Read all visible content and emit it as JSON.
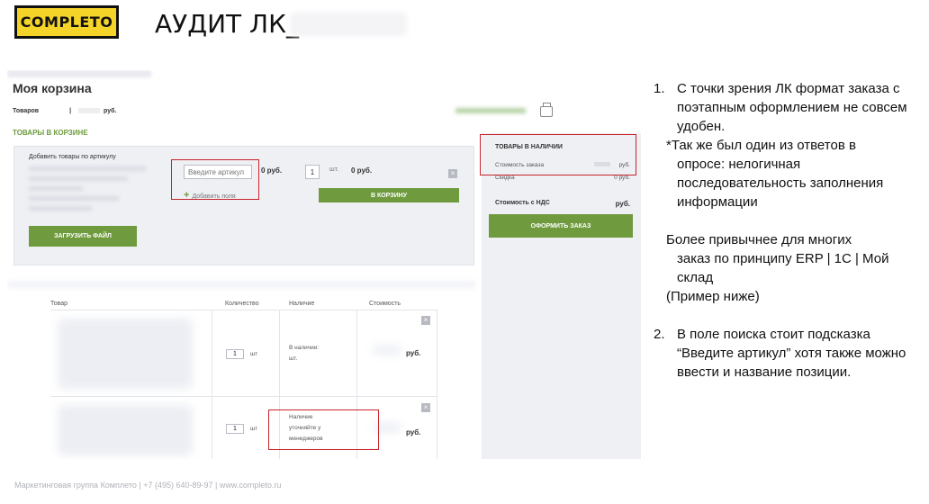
{
  "logo": {
    "text": "COMPLETO"
  },
  "slide": {
    "title": "АУДИТ ЛК_"
  },
  "cart": {
    "title": "Моя корзина",
    "goods_label": "Товаров",
    "goods_sep": "|",
    "goods_currency": "руб.",
    "in_cart_label": "ТОВАРЫ В КОРЗИНЕ",
    "add_by_article_title": "Добавить товары по артикулу",
    "article_placeholder": "Введите артикул",
    "price_zero": "0 руб.",
    "qty_value": "1",
    "qty_unit": "шт.",
    "price_zero_total": "0 руб.",
    "add_field_label": "Добавить поля",
    "to_cart_button": "В КОРЗИНУ",
    "upload_file_button": "ЗАГРУЗИТЬ ФАЙЛ"
  },
  "summary": {
    "title": "ТОВАРЫ В НАЛИЧИИ",
    "cost_label": "Стоимость заказа",
    "cost_value": "руб.",
    "discount_label": "Скидка",
    "discount_value": "0 руб.",
    "total_label": "Стоимость с НДС",
    "total_value": "руб.",
    "checkout_button": "ОФОРМИТЬ ЗАКАЗ"
  },
  "table": {
    "columns": [
      "Товар",
      "Количество",
      "Наличие",
      "Стоимость"
    ],
    "rows": [
      {
        "qty": "1",
        "unit": "шт",
        "availability": "В наличии:\nшт.",
        "price": "руб."
      },
      {
        "qty": "1",
        "unit": "шт",
        "availability": "Наличие\nуточняйте у\nменеджеров",
        "price": "руб."
      }
    ]
  },
  "notes": {
    "item1_num": "1.",
    "item1_text": "С точки зрения ЛК формат заказа с поэтапным оформлением не совсем удобен.",
    "note_asterisk_first": "*Так же был один из ответов в",
    "note_asterisk_rest": "опросе: нелогичная последовательность заполнения информации",
    "para_first": "Более привычнее для многих",
    "para_rest": "заказ по принципу ERP | 1С | Мой склад",
    "example": "(Пример ниже)",
    "item2_num": "2.",
    "item2_text": "В поле поиска стоит подсказка “Введите артикул” хотя также можно ввести и название позиции."
  },
  "footer": {
    "text": "Маркетинговая группа Комплето  |  +7 (495) 640-89-97  |  www.completo.ru"
  },
  "colors": {
    "accent_green": "#6f9b3e",
    "highlight_red": "#c8232a",
    "logo_yellow": "#f4d428"
  }
}
